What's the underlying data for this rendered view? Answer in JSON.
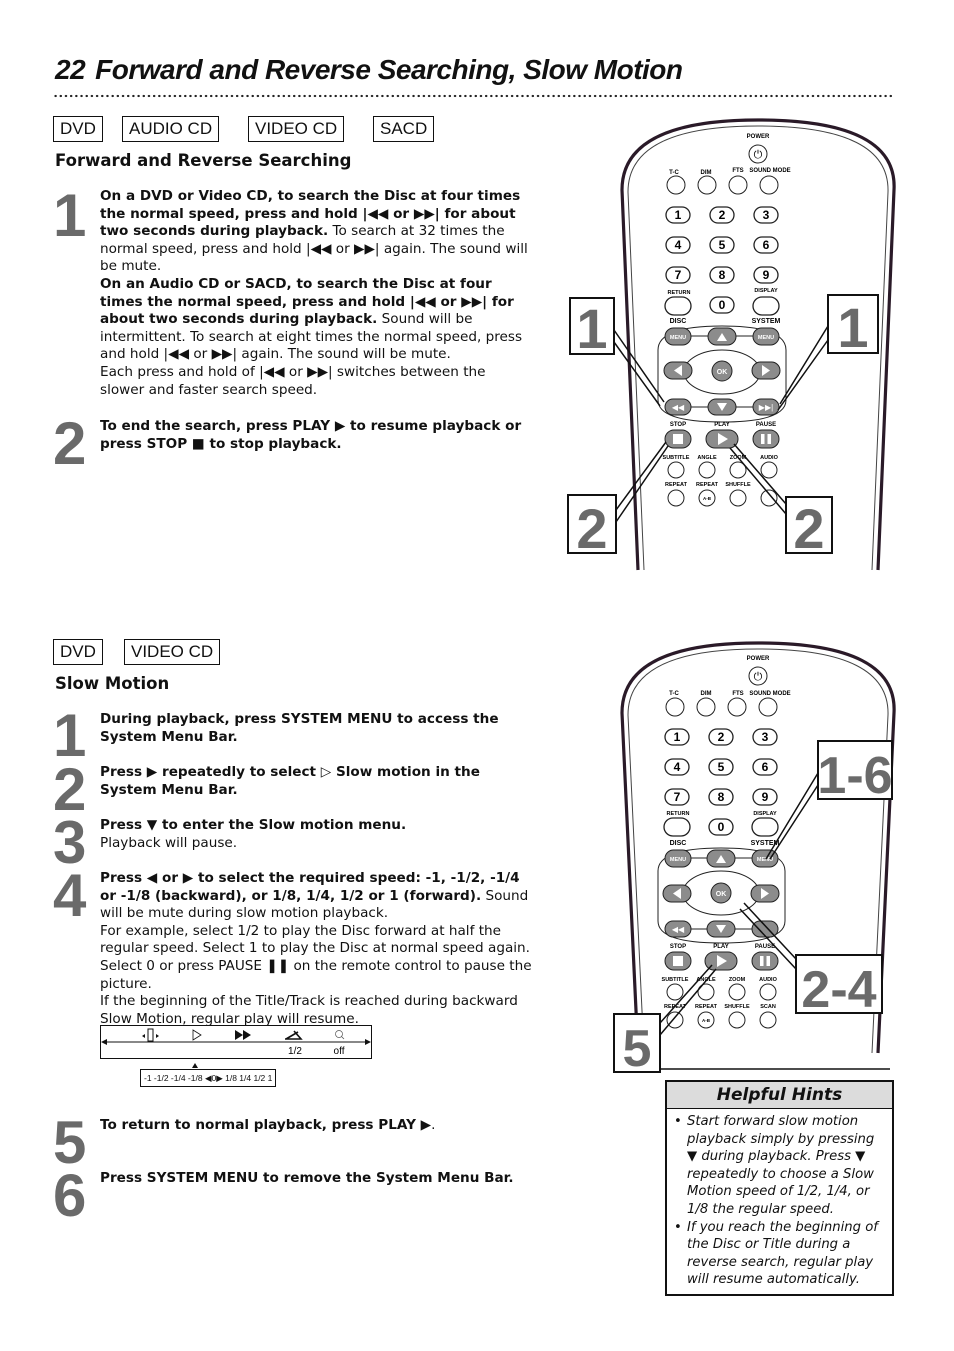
{
  "page": {
    "number": "22",
    "title": "Forward and Reverse Searching, Slow Motion"
  },
  "section1": {
    "tags": [
      "DVD",
      "AUDIO CD",
      "VIDEO CD",
      "SACD"
    ],
    "heading": "Forward and Reverse Searching",
    "steps": [
      {
        "number": "1",
        "paragraphs": [
          {
            "bold": "On a DVD or Video CD, to search the Disc at four times the normal speed, press and hold |◀◀ or ▶▶| for about two seconds during playback.",
            "normal": " To search at 32 times the normal speed, press and hold |◀◀ or ▶▶| again. The sound will be mute."
          },
          {
            "bold": "On an Audio CD or SACD, to search the Disc at four times the normal speed, press and hold |◀◀ or ▶▶| for about two seconds during playback.",
            "normal": " Sound will be intermittent. To search at eight times the normal speed, press and hold |◀◀ or ▶▶| again. The sound will be mute."
          },
          {
            "bold": "",
            "normal": "Each press and hold of |◀◀ or ▶▶| switches between the slower and faster search speed."
          }
        ]
      },
      {
        "number": "2",
        "paragraphs": [
          {
            "bold": "To end the search, press PLAY ▶ to resume playback or press STOP ■ to stop playback.",
            "normal": ""
          }
        ]
      }
    ],
    "callouts": [
      "1",
      "1",
      "2",
      "2"
    ]
  },
  "section2": {
    "tags": [
      "DVD",
      "VIDEO CD"
    ],
    "heading": "Slow Motion",
    "steps": [
      {
        "number": "1",
        "bold": "During playback, press SYSTEM MENU to access the System Menu Bar.",
        "normal": ""
      },
      {
        "number": "2",
        "bold": "Press ▶ repeatedly to select ▷ Slow motion in the System Menu Bar.",
        "normal": ""
      },
      {
        "number": "3",
        "bold": "Press ▼ to enter the Slow motion menu.",
        "normal": "Playback will pause."
      },
      {
        "number": "4",
        "bold": "Press ◀ or ▶ to select the required speed: -1, -1/2, -1/4 or -1/8 (backward), or 1/8, 1/4, 1/2 or 1 (forward).",
        "normal": " Sound will be mute during slow motion playback.",
        "extra": [
          "For example, select 1/2 to play the Disc forward at half the regular speed. Select 1 to play the Disc at normal speed again. Select 0 or press PAUSE ❚❚ on the remote control to pause the picture.",
          "If the beginning of the Title/Track is reached during backward Slow Motion, regular play will resume."
        ]
      },
      {
        "number": "5",
        "bold": "To return to normal playback, press PLAY ▶",
        "normal": "."
      },
      {
        "number": "6",
        "bold": "Press SYSTEM MENU to remove the System Menu Bar.",
        "normal": ""
      }
    ],
    "menu_bar": {
      "icons": [
        "step-icon",
        "slow-motion-icon",
        "fast-forward-icon",
        "angle-icon",
        "zoom-icon"
      ],
      "angle_value": "1/2",
      "zoom_value": "off",
      "speed_scale": "-1 -1/2 -1/4 -1/8 ◀0▶ 1/8  1/4  1/2  1"
    },
    "callouts": [
      "1-6",
      "2-4",
      "5"
    ]
  },
  "remote": {
    "power": "POWER",
    "top_row": [
      "T-C",
      "DIM",
      "FTS",
      "SOUND MODE"
    ],
    "digits": [
      "1",
      "2",
      "3",
      "4",
      "5",
      "6",
      "7",
      "8",
      "9",
      "0"
    ],
    "return": "RETURN",
    "display": "DISPLAY",
    "disc": "DISC",
    "system": "SYSTEM",
    "menu": "MENU",
    "ok": "OK",
    "stop": "STOP",
    "play": "PLAY",
    "pause": "PAUSE",
    "row_a": [
      "SUBTITLE",
      "ANGLE",
      "ZOOM",
      "AUDIO"
    ],
    "row_b": [
      "REPEAT",
      "REPEAT",
      "SHUFFLE",
      "SCAN"
    ],
    "ab": "A-B"
  },
  "hints": {
    "title": "Helpful Hints",
    "items": [
      "Start forward slow motion playback simply by pressing ▼ during playback. Press ▼ repeatedly to choose a Slow Motion speed of 1/2, 1/4, or 1/8 the regular speed.",
      "If you reach the beginning of the Disc or Title during a reverse search, regular play will resume automatically."
    ]
  }
}
